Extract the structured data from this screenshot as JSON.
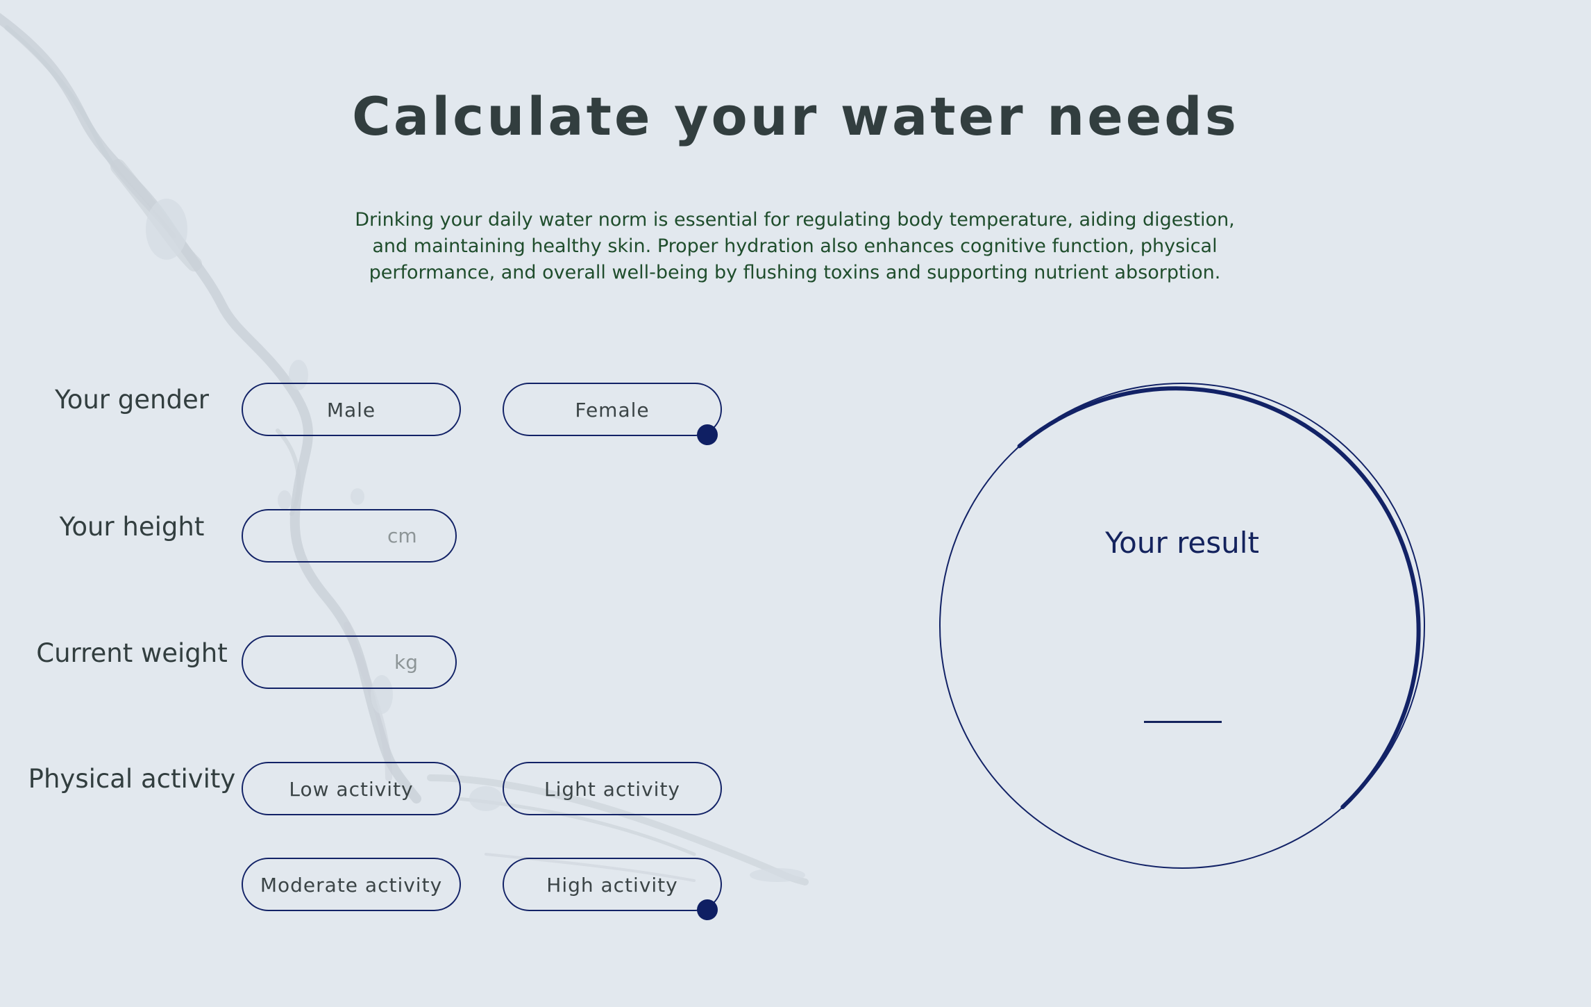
{
  "header": {
    "title": "Calculate your water needs",
    "intro": "Drinking your daily water norm is essential for regulating body temperature, aiding digestion, and maintaining healthy skin. Proper hydration also enhances cognitive function, physical performance, and overall well-being by flushing toxins and supporting nutrient absorption."
  },
  "form": {
    "gender": {
      "label": "Your gender",
      "options": [
        "Male",
        "Female"
      ],
      "selected": "Female"
    },
    "height": {
      "label": "Your height",
      "value": "",
      "unit": "cm"
    },
    "weight": {
      "label": "Current weight",
      "value": "",
      "unit": "kg"
    },
    "activity": {
      "label": "Physical activity",
      "options": [
        "Low activity",
        "Light activity",
        "Moderate activity",
        "High activity"
      ],
      "selected": "High activity"
    }
  },
  "result": {
    "title": "Your result",
    "value": ""
  },
  "colors": {
    "background": "#e2e8ee",
    "accent": "#122266",
    "heading": "#323e3f",
    "intro_text": "#1f4d2c"
  }
}
